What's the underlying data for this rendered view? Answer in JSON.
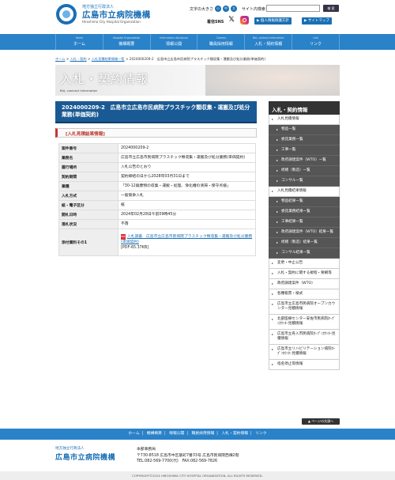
{
  "header": {
    "org_sub": "地方独立行政法人",
    "org_name": "広島市立病院機構",
    "org_en": "Hiroshima City Hospital Organization",
    "font_size_label": "文字の大きさ",
    "font_sizes": [
      "小",
      "中",
      "大"
    ],
    "search_label": "サイト内検索",
    "search_button": "検 索",
    "sns_label": "着信SNS",
    "privacy_button": "個人情報保護方針",
    "sitemap_button": "サイトマップ"
  },
  "gnav": [
    {
      "en": "Home",
      "jp": "ホーム"
    },
    {
      "en": "Hospital Organization",
      "jp": "機構概要"
    },
    {
      "en": "Information disclosure",
      "jp": "情報公開"
    },
    {
      "en": "Careers",
      "jp": "職員採用情報"
    },
    {
      "en": "Bid, contract information",
      "jp": "入札・契約情報"
    },
    {
      "en": "Link",
      "jp": "リンク"
    }
  ],
  "breadcrumb": {
    "items": [
      "ホーム",
      "入札・契約",
      "入札見積結果情報一覧"
    ],
    "current": "2024000209-2　広島市立広島市民病院プラスチック類収集・運搬及び処分業務(単価契約)"
  },
  "banner": {
    "title": "入札・契約情報",
    "subtitle": "Bid, contract information"
  },
  "page_title": "2024000209-2　広島市立広島市民病院プラスチック類収集・運搬及び処分業務(単価契約)",
  "section_heading": "[入札見積結果情報]",
  "table": [
    {
      "label": "案件番号",
      "value": "2024000209-2"
    },
    {
      "label": "業務名",
      "value": "広島市立広島市民病院プラスチック類収集・運搬及び処分業務(単価契約)"
    },
    {
      "label": "履行場所",
      "value": "入札公告のとおり"
    },
    {
      "label": "契約期間",
      "value": "契約締結の日から2028年03月31日まで"
    },
    {
      "label": "業種",
      "value": "「30-12廃棄物の収集・運搬・処理、浄化槽の清掃・保守点検」"
    },
    {
      "label": "入札方式",
      "value": "一般競争入札"
    },
    {
      "label": "紙・電子区分",
      "value": "紙"
    },
    {
      "label": "開札日時",
      "value": "2024年02月28日午前09時45分"
    },
    {
      "label": "落札状況",
      "value": "不落"
    }
  ],
  "attachment": {
    "label": "添付資料その1",
    "link_text": "入札調書　広島市立広島市民病院プラスチック類収集・運搬及び処分業務(単価契約)",
    "size": "[PDF-65.37KB]"
  },
  "sidebar": {
    "heading": "入札・契約情報",
    "items": [
      {
        "label": "入札見積情報",
        "sub": false
      },
      {
        "label": "物品一覧",
        "sub": true
      },
      {
        "label": "委託業務一覧",
        "sub": true
      },
      {
        "label": "工事一覧",
        "sub": true
      },
      {
        "label": "政府調達案件（WTO）一覧",
        "sub": true
      },
      {
        "label": "修繕（製造）一覧",
        "sub": true
      },
      {
        "label": "コンサル一覧",
        "sub": true
      },
      {
        "label": "入札見積結果情報",
        "sub": false
      },
      {
        "label": "物品結果一覧",
        "sub": true
      },
      {
        "label": "委託業務結果一覧",
        "sub": true
      },
      {
        "label": "工事結果一覧",
        "sub": true
      },
      {
        "label": "政府調達案件（WTO）結果一覧",
        "sub": true
      },
      {
        "label": "修繕（製造）結果一覧",
        "sub": true
      },
      {
        "label": "コンサル結果一覧",
        "sub": true
      },
      {
        "label": "変更・中止公告",
        "sub": false
      },
      {
        "label": "入札・契約に関する規程・要綱等",
        "sub": false
      },
      {
        "label": "政府調達案件（WTO）",
        "sub": false
      },
      {
        "label": "各種帳票・様式",
        "sub": false
      },
      {
        "label": "広島市立広島市民病院オープンカウンター見積情報",
        "sub": false
      },
      {
        "label": "北部医療センター安佐市民病院ｵｰﾌﾟﾝｶｳﾝﾀｰ見積情報",
        "sub": false
      },
      {
        "label": "広島市立舟入市民病院ｵｰﾌﾟﾝｶｳﾝﾀｰ見積情報",
        "sub": false
      },
      {
        "label": "広島市立リハビリテーション病院ｵｰﾌﾟﾝｶｳﾝﾀｰ見積情報",
        "sub": false
      },
      {
        "label": "指名停止等情報",
        "sub": false
      }
    ]
  },
  "page_top": "ページの先頭へ",
  "footer": {
    "nav": [
      "ホーム",
      "機構概要",
      "情報公開",
      "職員採用情報",
      "入札・契約情報",
      "リンク"
    ],
    "org_sub": "地方独立行政法人",
    "org_name": "広島市立病院機構",
    "office": "本部事務局",
    "address": "〒730-8518 広島市中区基町7番33号 広島市民病院西棟2階",
    "tel": "TEL:082-569-7700(代)　FAX:082-569-7826",
    "copyright": "COPYRIGHT©2024 HIROSHIMA CITY HOSPITAL ORGANIZATION, ALL RIGHTS RESERVED."
  }
}
